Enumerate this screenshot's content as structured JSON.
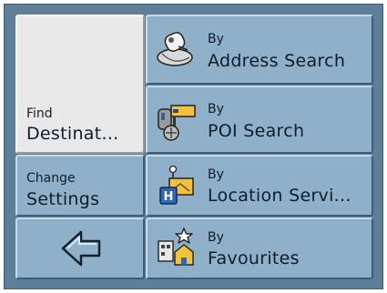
{
  "left_column": {
    "find": {
      "small": "Find",
      "big": "Destinat..."
    },
    "change": {
      "small": "Change",
      "big": "Settings"
    }
  },
  "options": [
    {
      "small": "By",
      "big": "Address Search",
      "icon": "address-search-icon"
    },
    {
      "small": "By",
      "big": "POI Search",
      "icon": "poi-search-icon"
    },
    {
      "small": "By",
      "big": "Location Servi...",
      "icon": "location-service-icon"
    },
    {
      "small": "By",
      "big": "Favourites",
      "icon": "favourites-icon"
    }
  ],
  "back": {
    "icon": "back-arrow-icon"
  },
  "colors": {
    "tile_blue": "#8fb0c8",
    "tile_light": "#e9e9e9",
    "frame": "#5f7f99",
    "text": "#0e1d2a"
  }
}
